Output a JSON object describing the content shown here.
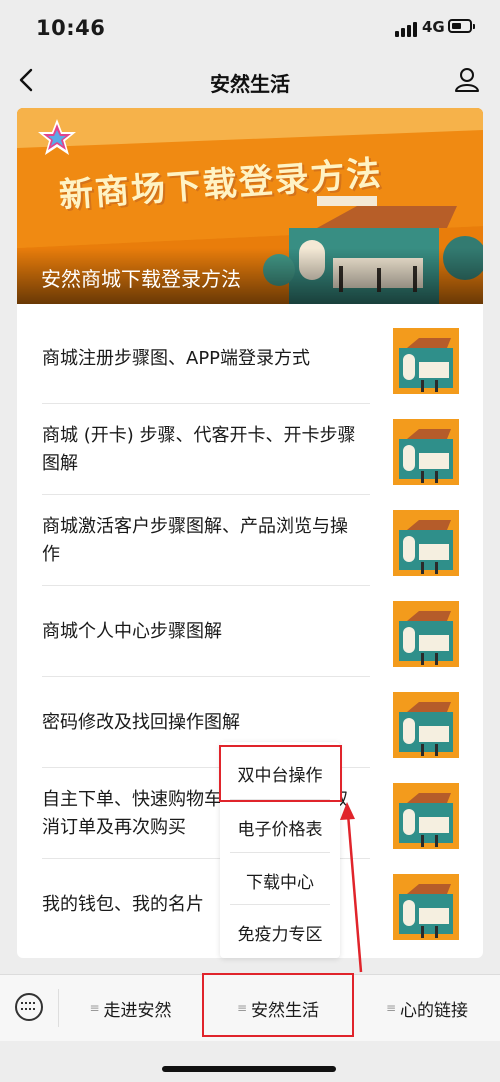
{
  "status_bar": {
    "time": "10:46",
    "network": "4G"
  },
  "nav": {
    "title": "安然生活"
  },
  "banner": {
    "heading": "新商场下载登录方法",
    "caption": "安然商城下载登录方法"
  },
  "articles": [
    {
      "title": "商城注册步骤图、APP端登录方式"
    },
    {
      "title": "商城 (开卡) 步骤、代客开卡、开卡步骤图解"
    },
    {
      "title": "商城激活客户步骤图解、产品浏览与操作"
    },
    {
      "title": "商城个人中心步骤图解"
    },
    {
      "title": "密码修改及找回操作图解"
    },
    {
      "title": "自主下单、快速购物车、订单查询、取消订单及再次购买"
    },
    {
      "title": "我的钱包、我的名片"
    }
  ],
  "popup_menu": {
    "items": [
      {
        "label": "双中台操作"
      },
      {
        "label": "电子价格表"
      },
      {
        "label": "下载中心"
      },
      {
        "label": "免疫力专区"
      }
    ]
  },
  "bottom_menu": {
    "items": [
      {
        "label": "走进安然"
      },
      {
        "label": "安然生活"
      },
      {
        "label": "心的链接"
      }
    ]
  },
  "colors": {
    "highlight": "#e0242b",
    "banner_orange": "#f39b1c"
  }
}
